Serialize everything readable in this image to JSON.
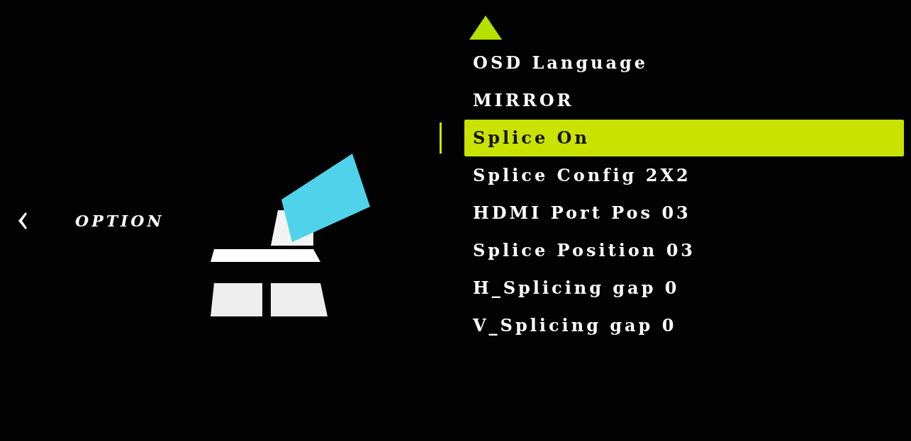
{
  "section": {
    "title": "OPTION"
  },
  "menu": [
    {
      "label": "OSD Language",
      "selected": false
    },
    {
      "label": "MIRROR",
      "selected": false
    },
    {
      "label": "Splice On",
      "selected": true
    },
    {
      "label": "Splice Config 2X2",
      "selected": false
    },
    {
      "label": "HDMI Port Pos 03",
      "selected": false
    },
    {
      "label": "Splice Position 03",
      "selected": false
    },
    {
      "label": "H_Splicing gap 0",
      "selected": false
    },
    {
      "label": "V_Splicing gap 0",
      "selected": false
    }
  ]
}
